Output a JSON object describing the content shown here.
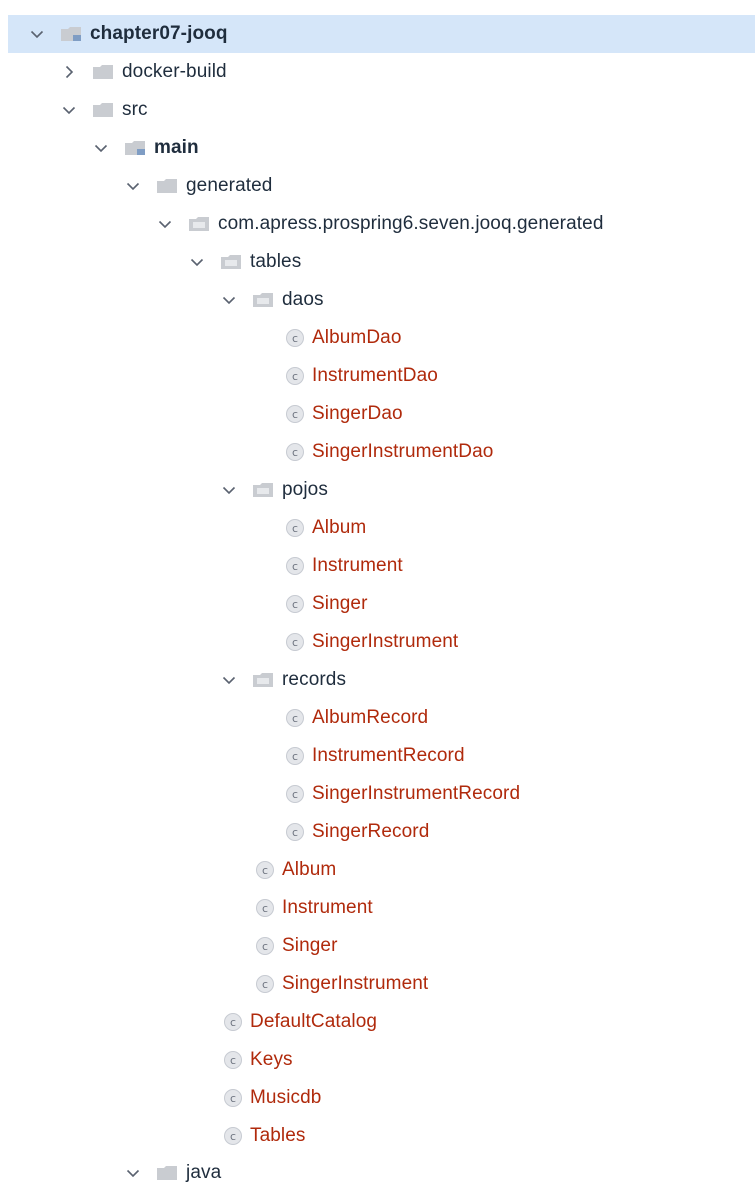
{
  "tree": {
    "root": {
      "label": "chapter07-jooq"
    },
    "docker_build": {
      "label": "docker-build"
    },
    "src": {
      "label": "src"
    },
    "main": {
      "label": "main"
    },
    "generated": {
      "label": "generated"
    },
    "package": {
      "label": "com.apress.prospring6.seven.jooq.generated"
    },
    "tables": {
      "label": "tables"
    },
    "daos": {
      "label": "daos",
      "items": [
        "AlbumDao",
        "InstrumentDao",
        "SingerDao",
        "SingerInstrumentDao"
      ]
    },
    "pojos": {
      "label": "pojos",
      "items": [
        "Album",
        "Instrument",
        "Singer",
        "SingerInstrument"
      ]
    },
    "records": {
      "label": "records",
      "items": [
        "AlbumRecord",
        "InstrumentRecord",
        "SingerInstrumentRecord",
        "SingerRecord"
      ]
    },
    "tables_classes": [
      "Album",
      "Instrument",
      "Singer",
      "SingerInstrument"
    ],
    "generated_classes": [
      "DefaultCatalog",
      "Keys",
      "Musicdb",
      "Tables"
    ],
    "java": {
      "label": "java"
    }
  },
  "icons": {
    "expanded": "chevron-down-icon",
    "collapsed": "chevron-right-icon",
    "folder": "folder-icon",
    "module_folder": "module-folder-icon",
    "class": "class-icon",
    "class_letter": "c"
  },
  "colors": {
    "selection": "#d5e6f9",
    "folder_text": "#1f2d3d",
    "class_text": "#b02a0c",
    "folder_fill": "#c9ccd1",
    "module_marker": "#7f9dc4"
  }
}
